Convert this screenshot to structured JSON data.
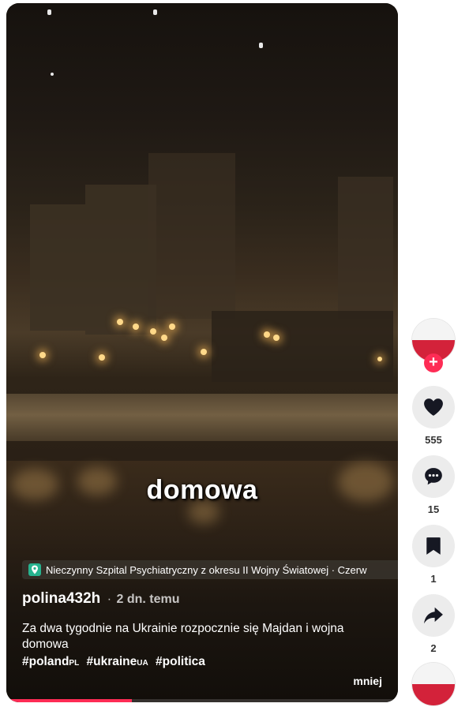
{
  "video": {
    "caption_overlay": "domowa",
    "location": "Nieczynny Szpital Psychiatryczny z okresu II Wojny Światowej · Czerw",
    "author": "polina432h",
    "separator": "·",
    "time_ago": "2 dn. temu",
    "description": "Za dwa tygodnie na Ukrainie rozpocznie się Majdan i wojna domowa",
    "hashtags": [
      {
        "text": "#poland",
        "suffix": "PL"
      },
      {
        "text": "#ukraine",
        "suffix": "UA"
      },
      {
        "text": "#politica",
        "suffix": ""
      }
    ],
    "more_label": "mniej",
    "progress": 0.32
  },
  "actions": {
    "likes": "555",
    "comments": "15",
    "saves": "1",
    "shares": "2"
  },
  "colors": {
    "accent": "#fe2c55",
    "location_icon": "#27b38f",
    "avatar_red": "#d3223a"
  },
  "icons": [
    "location-pin-icon",
    "plus-icon",
    "heart-icon",
    "comment-icon",
    "bookmark-icon",
    "share-icon"
  ]
}
